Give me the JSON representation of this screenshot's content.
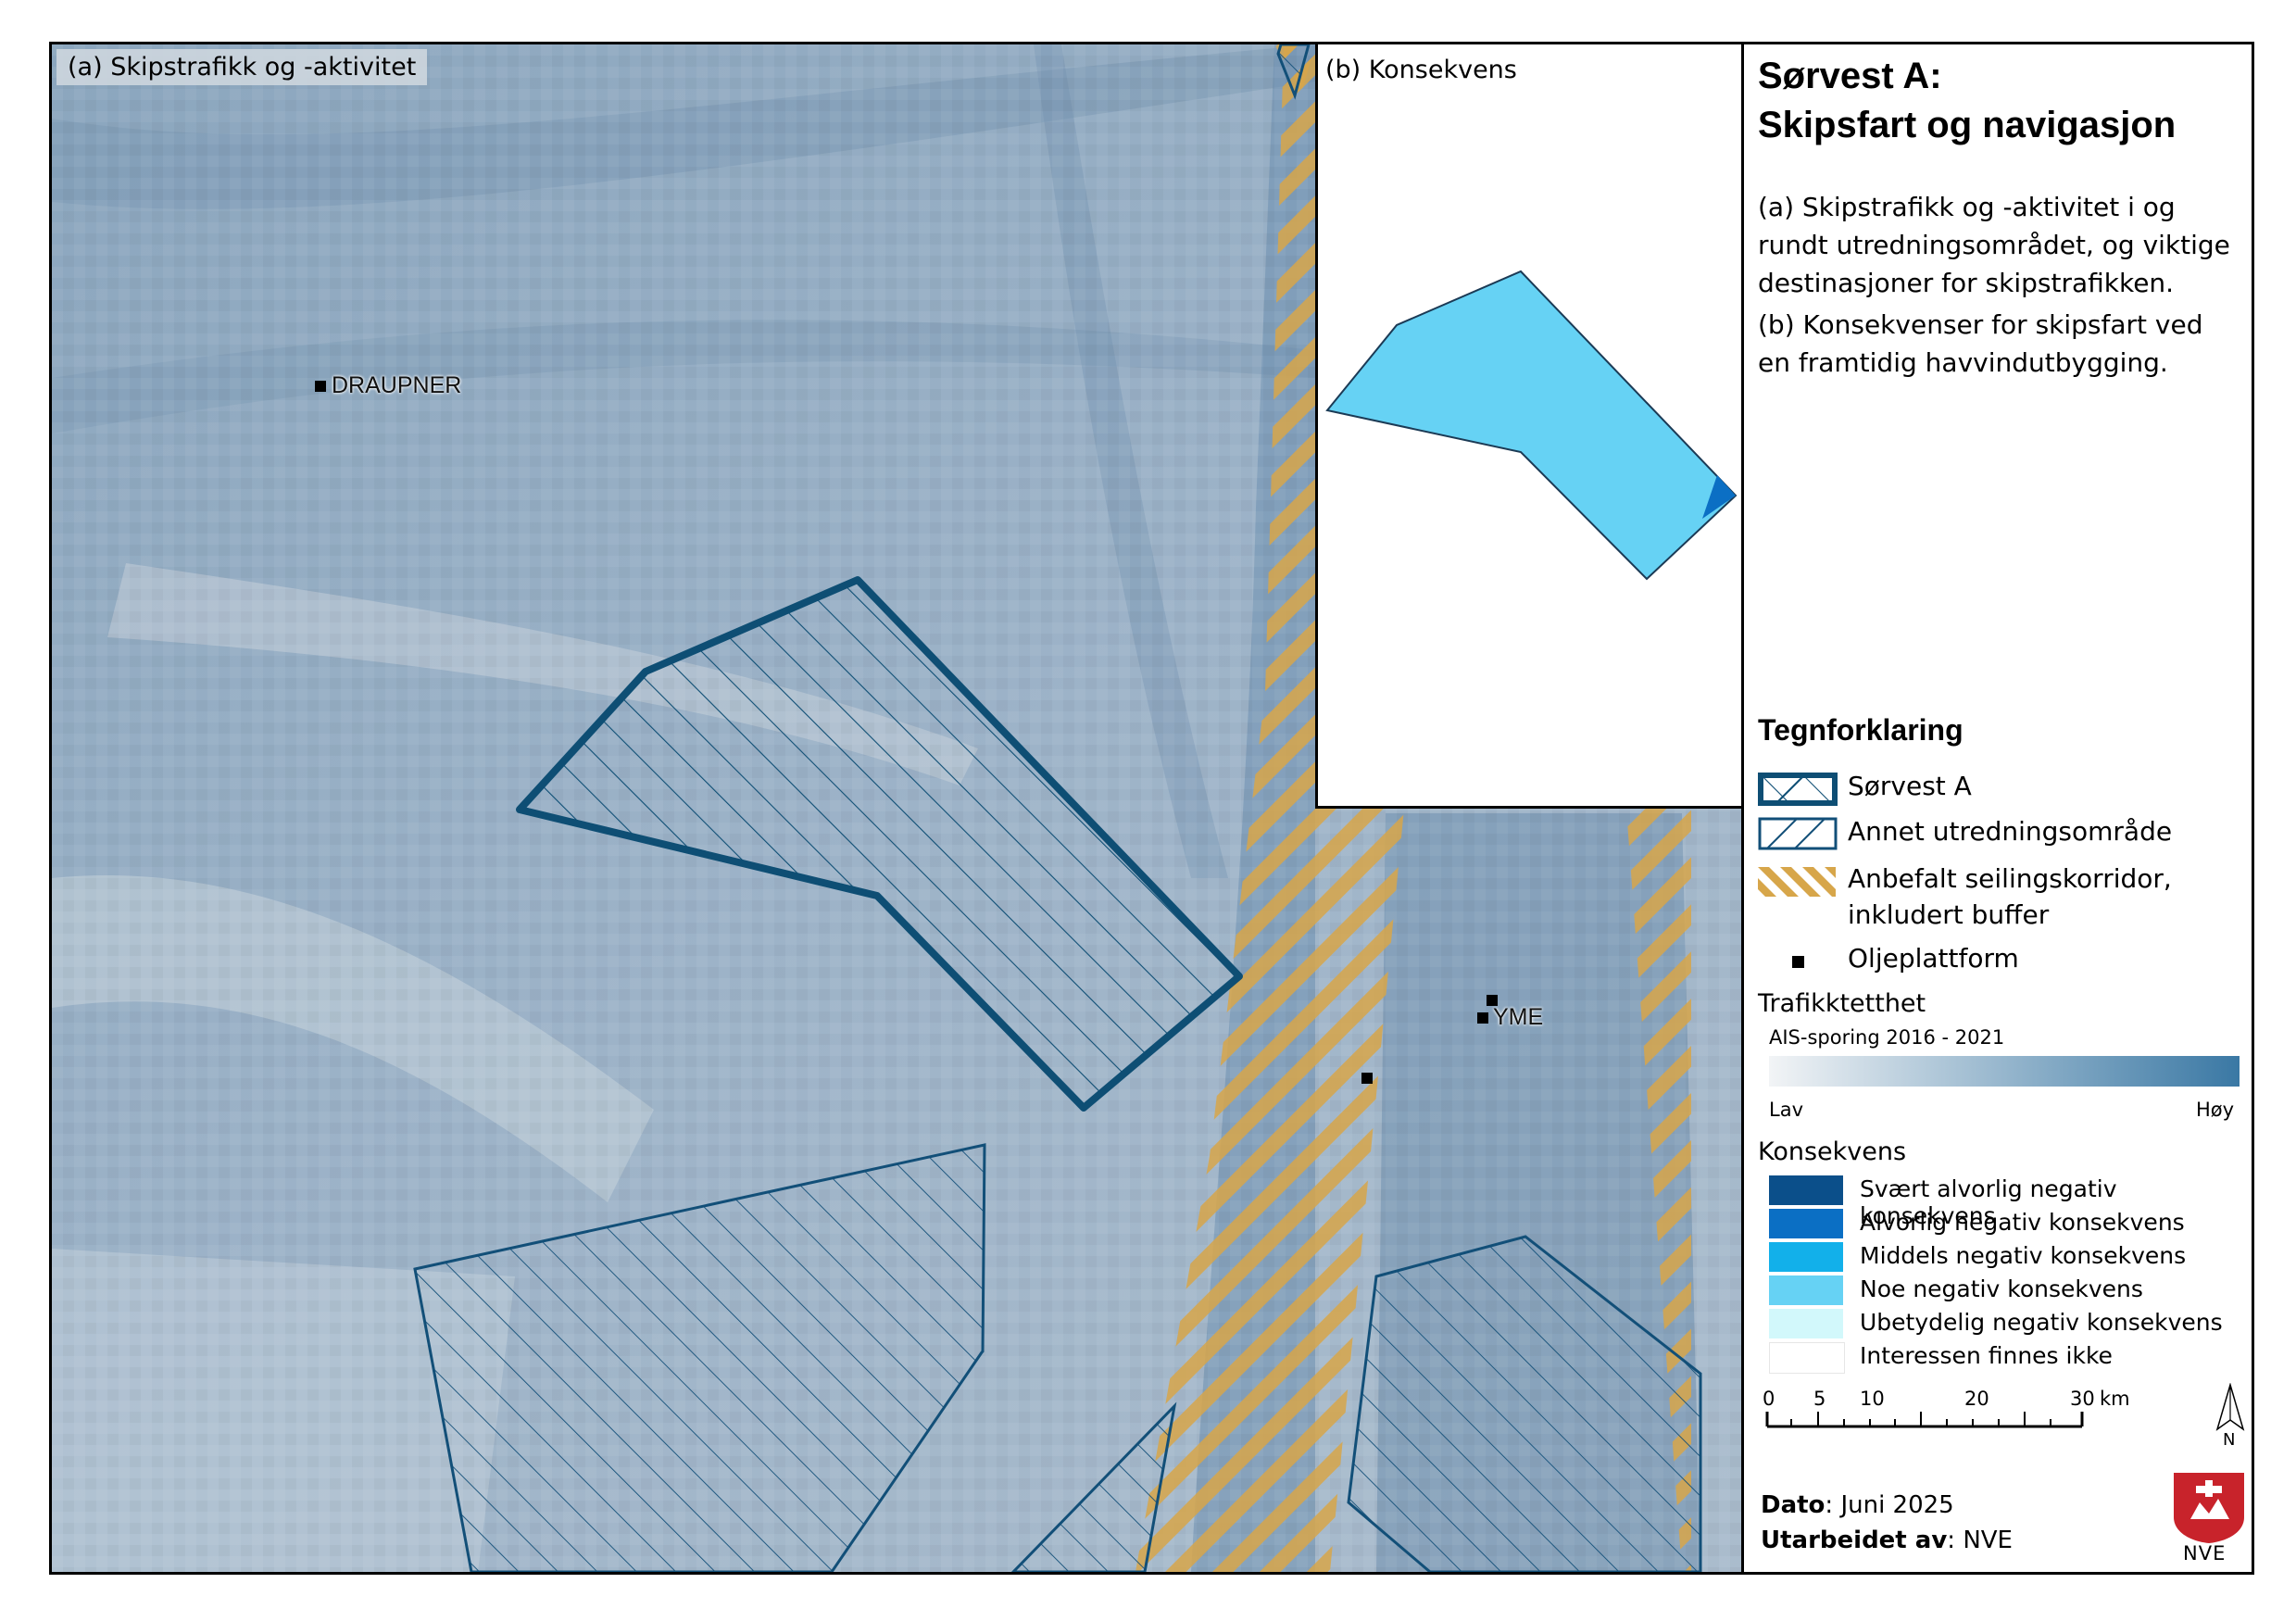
{
  "panel_a": {
    "title": "(a) Skipstrafikk og -aktivitet"
  },
  "panel_b": {
    "title": "(b) Konsekvens"
  },
  "platforms": [
    {
      "label": "DRAUPNER"
    },
    {
      "label": "YME"
    }
  ],
  "side": {
    "title_line1": "Sørvest A:",
    "title_line2": "Skipsfart og navigasjon",
    "desc_a": "(a) Skipstrafikk og -aktivitet i og rundt utredningsområdet, og viktige destinasjoner for skipstrafikken.",
    "desc_b": "(b) Konsekvenser for skipsfart ved en framtidig havvindutbygging.",
    "legend_title": "Tegnforklaring",
    "legend_items": [
      {
        "label": "Sørvest A"
      },
      {
        "label": "Annet utredningsområde"
      },
      {
        "label": "Anbefalt seilingskorridor, inkludert buffer"
      },
      {
        "label": "Oljeplattform"
      }
    ],
    "traffic": {
      "title": "Trafikktetthet",
      "subtitle": "AIS-sporing 2016 - 2021",
      "low": "Lav",
      "high": "Høy",
      "color_low": "#f2f4f6",
      "color_high": "#3a78a4"
    },
    "consequence": {
      "title": "Konsekvens",
      "classes": [
        {
          "label": "Svært alvorlig negativ konsekvens",
          "color": "#0b4f8a"
        },
        {
          "label": "Alvorlig negativ konsekvens",
          "color": "#0b6fc4"
        },
        {
          "label": "Middels negativ konsekvens",
          "color": "#12b0ea"
        },
        {
          "label": "Noe negativ konsekvens",
          "color": "#66d2f4"
        },
        {
          "label": "Ubetydelig negativ konsekvens",
          "color": "#d2f8fb"
        },
        {
          "label": "Interessen finnes ikke",
          "color": "#ffffff"
        }
      ]
    },
    "scale": {
      "ticks": [
        "0",
        "5",
        "10",
        "20",
        "30"
      ],
      "unit": "km"
    },
    "north": "N",
    "date_label": "Dato",
    "date_value": ": Juni 2025",
    "author_label": "Utarbeidet av",
    "author_value": ": NVE",
    "logo_text": "NVE"
  },
  "colors": {
    "sorvest": "#0e4e74",
    "annet": "#124f78",
    "corridor": "#d7a64a",
    "inset_fill": "#66d2f4",
    "inset_edge": "#0b6fc4"
  }
}
